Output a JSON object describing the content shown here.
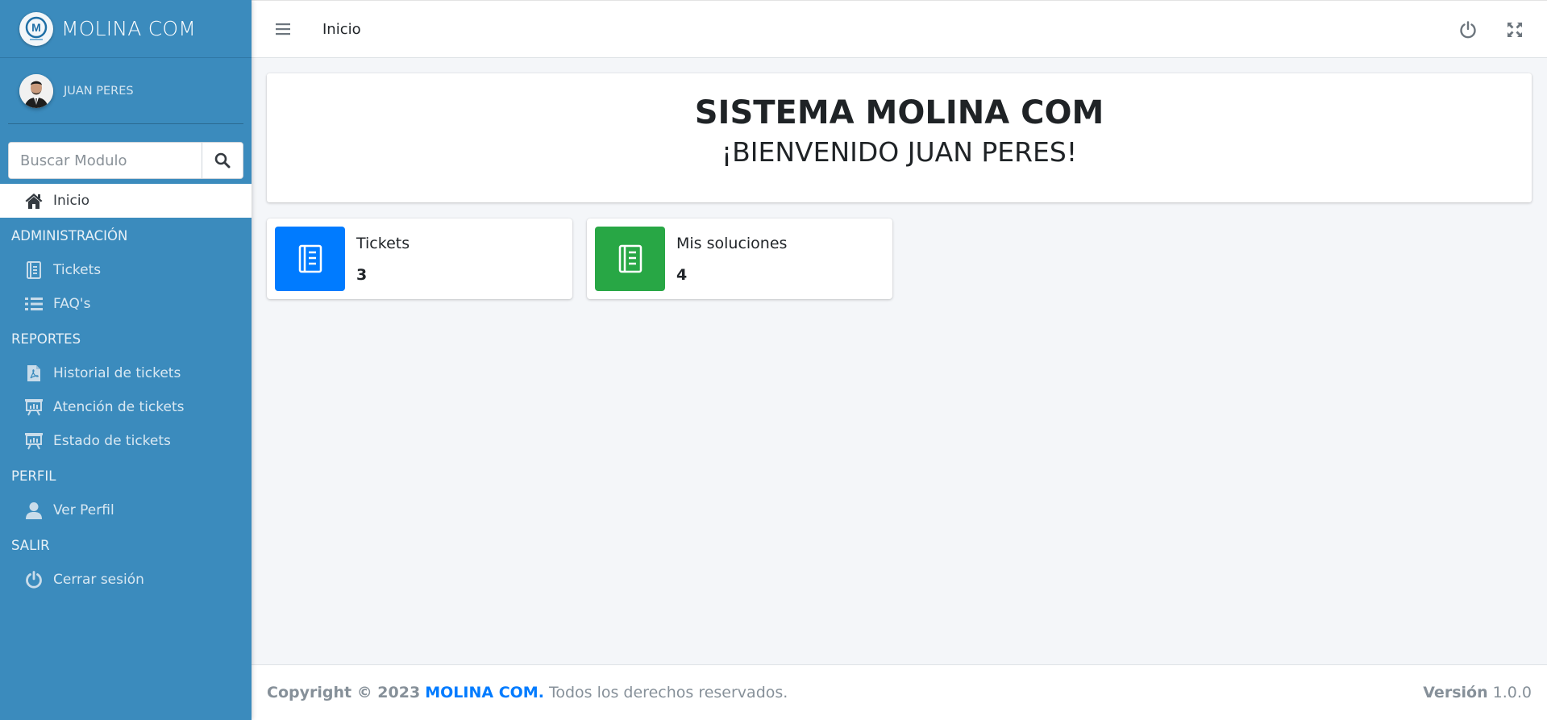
{
  "brand": {
    "name": "MOLINA COM",
    "logo_letter": "M"
  },
  "user": {
    "name": "JUAN PERES"
  },
  "search": {
    "placeholder": "Buscar Modulo"
  },
  "nav": {
    "active": {
      "label": "Inicio",
      "icon": "home-icon"
    },
    "sections": [
      {
        "header": "ADMINISTRACIÓN",
        "items": [
          {
            "label": "Tickets",
            "icon": "book-icon"
          },
          {
            "label": "FAQ's",
            "icon": "list-icon"
          }
        ]
      },
      {
        "header": "REPORTES",
        "items": [
          {
            "label": "Historial de tickets",
            "icon": "file-pdf-icon"
          },
          {
            "label": "Atención de tickets",
            "icon": "chart-board-icon"
          },
          {
            "label": "Estado de tickets",
            "icon": "chart-board-icon"
          }
        ]
      },
      {
        "header": "PERFIL",
        "items": [
          {
            "label": "Ver Perfil",
            "icon": "user-icon"
          }
        ]
      },
      {
        "header": "SALIR",
        "items": [
          {
            "label": "Cerrar sesión",
            "icon": "power-icon"
          }
        ]
      }
    ]
  },
  "topbar": {
    "link": "Inicio"
  },
  "welcome": {
    "title": "SISTEMA MOLINA COM",
    "subtitle": "¡BIENVENIDO JUAN PERES!"
  },
  "cards": [
    {
      "label": "Tickets",
      "value": "3",
      "color": "#007bff",
      "icon": "book-icon"
    },
    {
      "label": "Mis soluciones",
      "value": "4",
      "color": "#28a745",
      "icon": "book-icon"
    }
  ],
  "footer": {
    "copyright": "Copyright © 2023",
    "brand": "MOLINA COM.",
    "rights": "Todos los derechos reservados.",
    "version_label": "Versión",
    "version": "1.0.0"
  }
}
